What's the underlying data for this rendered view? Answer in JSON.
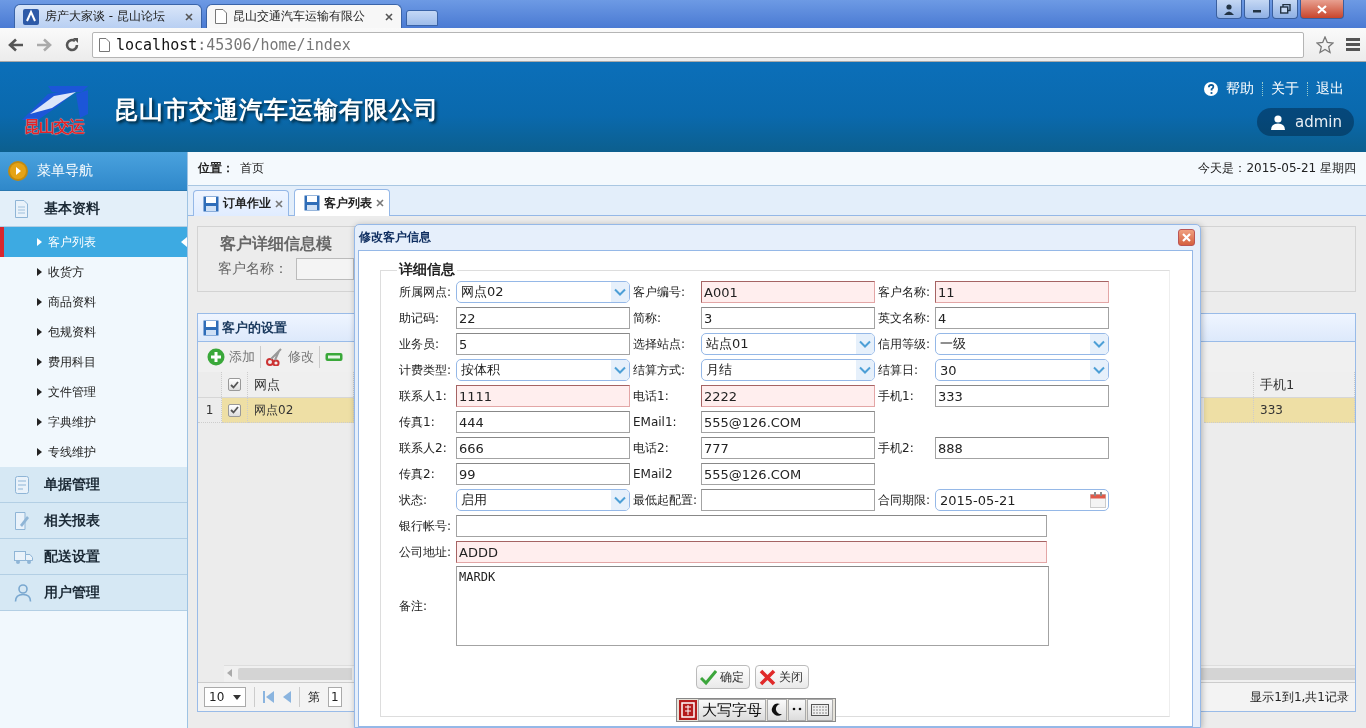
{
  "browser": {
    "tabs": [
      {
        "title": "房产大家谈 - 昆山论坛",
        "selected": false
      },
      {
        "title": "昆山交通汽车运输有限公",
        "selected": true
      }
    ],
    "address_host": "localhost",
    "address_path": ":45306/home/index"
  },
  "header": {
    "logo_text": "昆山交运",
    "title": "昆山市交通汽车运输有限公司",
    "links": [
      "帮助",
      "关于",
      "退出"
    ],
    "user": "admin"
  },
  "sidebar": {
    "title": "菜单导航",
    "groups": [
      {
        "label": "基本资料",
        "expanded": true,
        "items": [
          {
            "label": "客户列表",
            "selected": true
          },
          {
            "label": "收货方",
            "selected": false
          },
          {
            "label": "商品资料",
            "selected": false
          },
          {
            "label": "包规资料",
            "selected": false
          },
          {
            "label": "费用科目",
            "selected": false
          },
          {
            "label": "文件管理",
            "selected": false
          },
          {
            "label": "字典维护",
            "selected": false
          },
          {
            "label": "专线维护",
            "selected": false
          }
        ]
      },
      {
        "label": "单据管理",
        "expanded": false
      },
      {
        "label": "相关报表",
        "expanded": false
      },
      {
        "label": "配送设置",
        "expanded": false
      },
      {
        "label": "用户管理",
        "expanded": false
      }
    ]
  },
  "breadcrumb": {
    "label": "位置：",
    "page": "首页",
    "date": "今天是：2015-05-21 星期四"
  },
  "tabs": [
    {
      "label": "订单作业",
      "selected": false
    },
    {
      "label": "客户列表",
      "selected": true
    }
  ],
  "search_panel": {
    "title": "客户详细信息模",
    "label": "客户名称："
  },
  "grid": {
    "title": "客户的设置",
    "toolbar": [
      "添加",
      "修改"
    ],
    "columns": [
      "网点",
      "手机1"
    ],
    "header_checked": true,
    "rows": [
      {
        "number": "1",
        "checked": true,
        "selected": true,
        "cells": [
          "网点02",
          "333"
        ]
      }
    ],
    "page_size": "10",
    "page_label": "第",
    "page": "1",
    "summary": "显示1到1,共1记录"
  },
  "dialog": {
    "title": "修改客户信息",
    "legend": "详细信息",
    "rows": [
      [
        {
          "label": "所属网点:",
          "kind": "combo",
          "value": "网点02",
          "invalid": false
        },
        {
          "label": "客户编号:",
          "kind": "text",
          "value": "A001",
          "invalid": true
        },
        {
          "label": "客户名称:",
          "kind": "text",
          "value": "11",
          "invalid": true
        }
      ],
      [
        {
          "label": "助记码:",
          "kind": "text",
          "value": "22",
          "invalid": false
        },
        {
          "label": "简称:",
          "kind": "text",
          "value": "3",
          "invalid": false
        },
        {
          "label": "英文名称:",
          "kind": "text",
          "value": "4",
          "invalid": false
        }
      ],
      [
        {
          "label": "业务员:",
          "kind": "text",
          "value": "5",
          "invalid": false
        },
        {
          "label": "选择站点:",
          "kind": "combo",
          "value": "站点01",
          "invalid": false
        },
        {
          "label": "信用等级:",
          "kind": "combo",
          "value": "一级",
          "invalid": false
        }
      ],
      [
        {
          "label": "计费类型:",
          "kind": "combo",
          "value": "按体积",
          "invalid": false
        },
        {
          "label": "结算方式:",
          "kind": "combo",
          "value": "月结",
          "invalid": false
        },
        {
          "label": "结算日:",
          "kind": "combo",
          "value": "30",
          "invalid": false
        }
      ],
      [
        {
          "label": "联系人1:",
          "kind": "text",
          "value": "1111",
          "invalid": true
        },
        {
          "label": "电话1:",
          "kind": "text",
          "value": "2222",
          "invalid": true
        },
        {
          "label": "手机1:",
          "kind": "text",
          "value": "333",
          "invalid": false
        }
      ],
      [
        {
          "label": "传真1:",
          "kind": "text",
          "value": "444",
          "invalid": false
        },
        {
          "label": "EMail1:",
          "kind": "text",
          "value": "555@126.COM",
          "invalid": false
        }
      ],
      [
        {
          "label": "联系人2:",
          "kind": "text",
          "value": "666",
          "invalid": false
        },
        {
          "label": "电话2:",
          "kind": "text",
          "value": "777",
          "invalid": false
        },
        {
          "label": "手机2:",
          "kind": "text",
          "value": "888",
          "invalid": false
        }
      ],
      [
        {
          "label": "传真2:",
          "kind": "text",
          "value": "99",
          "invalid": false
        },
        {
          "label": "EMail2",
          "kind": "text",
          "value": "555@126.COM",
          "invalid": false
        }
      ],
      [
        {
          "label": "状态:",
          "kind": "combo",
          "value": "启用",
          "invalid": false
        },
        {
          "label": "最低起配置:",
          "kind": "text",
          "invalid": false
        },
        {
          "label": "合同期限:",
          "kind": "date",
          "value": "2015-05-21",
          "invalid": false
        }
      ],
      [
        {
          "label": "银行帐号:",
          "kind": "wide",
          "invalid": false
        }
      ],
      [
        {
          "label": "公司地址:",
          "kind": "wide",
          "value": "ADDD",
          "invalid": true
        }
      ],
      [
        {
          "label": "备注:",
          "kind": "textarea",
          "value": "MARDK",
          "invalid": false
        }
      ]
    ],
    "buttons": [
      "确定",
      "关闭"
    ]
  },
  "ime": {
    "label": "大写字母"
  }
}
